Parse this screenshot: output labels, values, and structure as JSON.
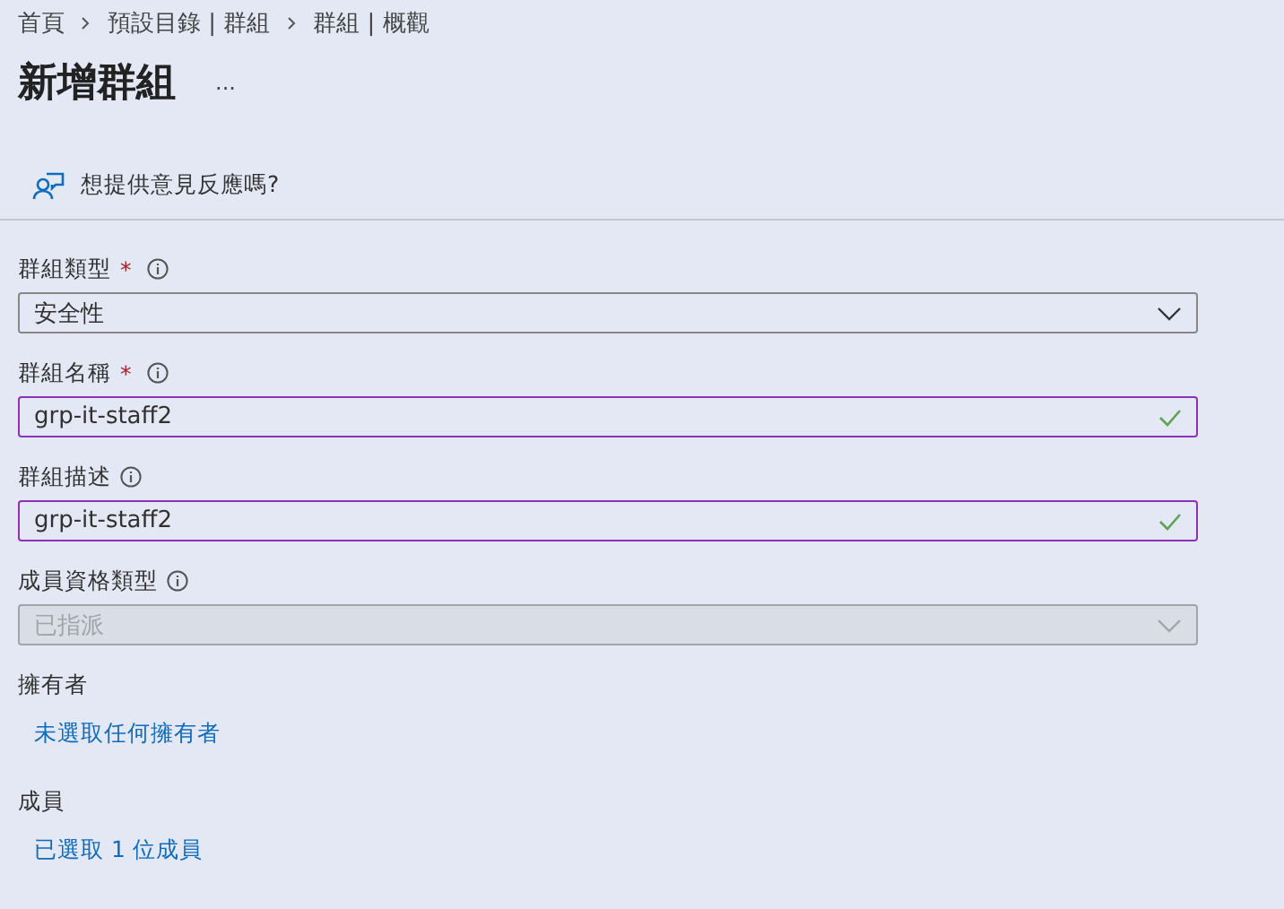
{
  "breadcrumb": [
    "首頁",
    "預設目錄 | 群組",
    "群組 | 概觀"
  ],
  "title": "新增群組",
  "more": "...",
  "feedback": "想提供意見反應嗎?",
  "fields": [
    {
      "kind": "dropdown",
      "label": "群組類型",
      "required_mark": "*",
      "value": "安全性",
      "disabled": false
    },
    {
      "kind": "text",
      "label": "群組名稱",
      "required_mark": "*",
      "value": "grp-it-staff2",
      "valid": true
    },
    {
      "kind": "text",
      "label": "群組描述",
      "value": "grp-it-staff2",
      "valid": true
    },
    {
      "kind": "dropdown",
      "label": "成員資格類型",
      "value": "已指派",
      "disabled": true
    }
  ],
  "sections": [
    {
      "label": "擁有者",
      "link": "未選取任何擁有者"
    },
    {
      "label": "成員",
      "link": "已選取 1 位成員"
    }
  ]
}
